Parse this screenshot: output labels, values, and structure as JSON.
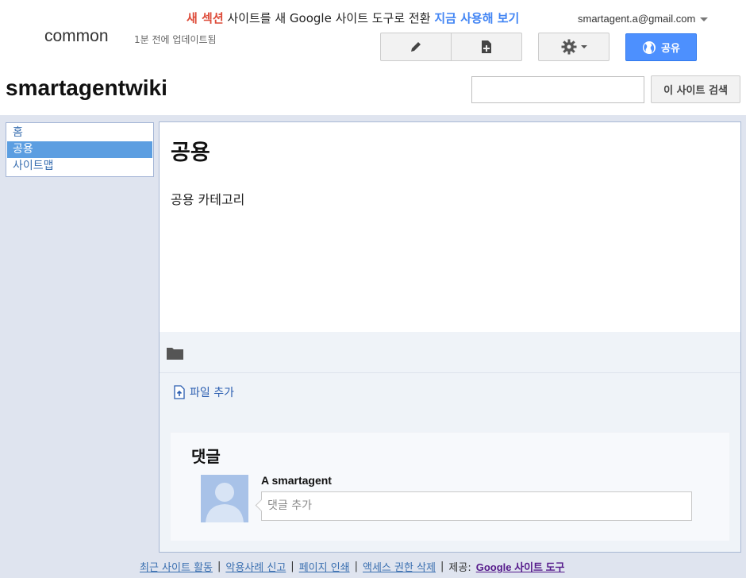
{
  "announcement": {
    "new_section": "새 섹션",
    "text": " 사이트를 새 Google 사이트 도구로 전환 ",
    "link": "지금 사용해 보기"
  },
  "account": {
    "email": "smartagent.a@gmail.com"
  },
  "header": {
    "site_label": "common",
    "updated": "1분 전에 업데이트됨",
    "share_label": "공유"
  },
  "site": {
    "title": "smartagentwiki"
  },
  "search": {
    "placeholder": "",
    "button_label": "이 사이트 검색"
  },
  "sidebar": {
    "items": [
      {
        "label": "홈"
      },
      {
        "label": "공용"
      },
      {
        "label": "사이트맵"
      }
    ]
  },
  "page": {
    "title": "공용",
    "body": "공용 카테고리"
  },
  "attachments": {
    "add_file_label": "파일 추가"
  },
  "comments": {
    "title": "댓글",
    "author": "A smartagent",
    "placeholder": "댓글 추가"
  },
  "footer": {
    "links": [
      "최근 사이트 활동",
      "악용사례 신고",
      "페이지 인쇄",
      "액세스 권한 삭제"
    ],
    "provided_by": "제공:",
    "brand": "Google 사이트 도구"
  },
  "icons": {
    "edit": "pencil-icon",
    "new_page": "new-page-icon",
    "settings": "gear-icon",
    "share": "globe-icon",
    "folder": "folder-icon",
    "add_file": "file-upload-icon",
    "avatar": "user-silhouette-icon"
  },
  "colors": {
    "accent": "#4d90fe",
    "announcement_red": "#dd4b39",
    "link_blue": "#4285f4",
    "nav_active": "#5c9ee1"
  }
}
